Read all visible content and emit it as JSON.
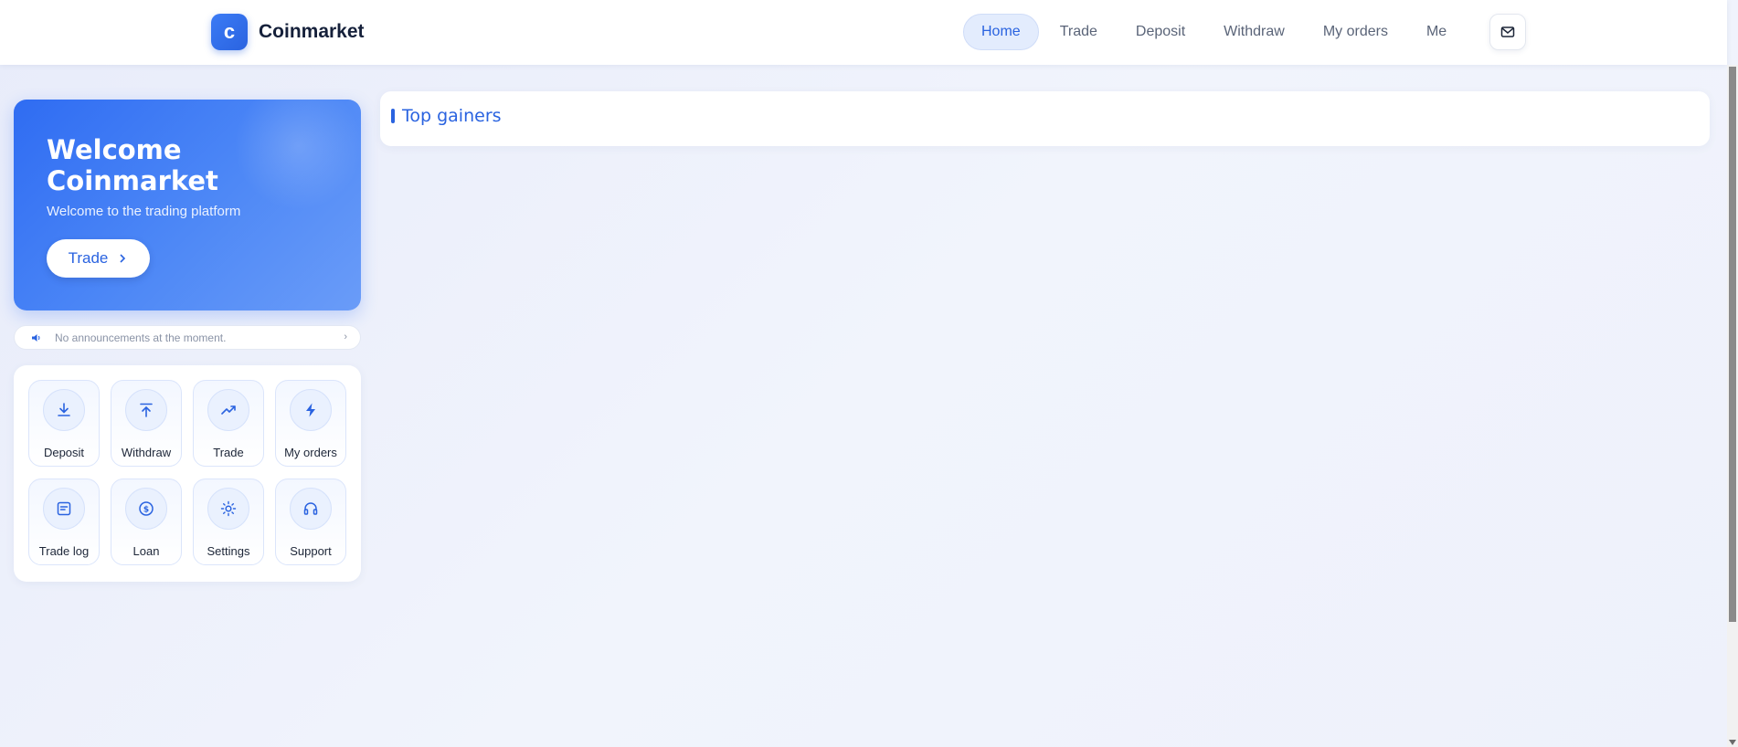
{
  "header": {
    "logo_letter": "c",
    "brand": "Coinmarket",
    "nav": [
      {
        "label": "Home",
        "active": true
      },
      {
        "label": "Trade",
        "active": false
      },
      {
        "label": "Deposit",
        "active": false
      },
      {
        "label": "Withdraw",
        "active": false
      },
      {
        "label": "My orders",
        "active": false
      },
      {
        "label": "Me",
        "active": false
      }
    ],
    "mail_icon": "mail-icon"
  },
  "welcome": {
    "title": "Welcome Coinmarket",
    "subtitle": "Welcome to the trading platform",
    "button_label": "Trade",
    "button_icon": "chevron-right-icon"
  },
  "announcement": {
    "icon": "speaker-icon",
    "text": "No announcements at the moment.",
    "arrow": "›"
  },
  "quick_actions": [
    {
      "label": "Deposit",
      "icon": "download-icon"
    },
    {
      "label": "Withdraw",
      "icon": "upload-icon"
    },
    {
      "label": "Trade",
      "icon": "trend-up-icon"
    },
    {
      "label": "My orders",
      "icon": "lightning-icon"
    },
    {
      "label": "Trade log",
      "icon": "document-icon"
    },
    {
      "label": "Loan",
      "icon": "dollar-coin-icon"
    },
    {
      "label": "Settings",
      "icon": "sun-gear-icon"
    },
    {
      "label": "Support",
      "icon": "headset-icon"
    }
  ],
  "main": {
    "top_gainers_title": "Top gainers"
  },
  "colors": {
    "accent": "#2a63e0",
    "accent_light": "#e3ecfd",
    "background": "#eef1fb"
  }
}
